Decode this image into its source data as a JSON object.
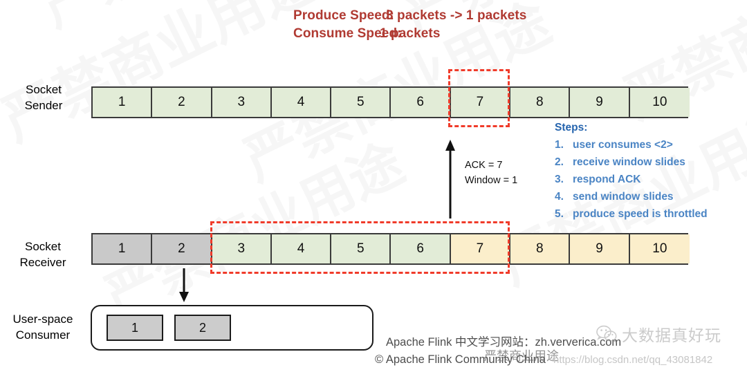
{
  "header": {
    "produce_label": "Produce Speed:",
    "produce_value": "3 packets -> 1 packets",
    "consume_label": "Consume Speed:",
    "consume_value": "1 packets",
    "accent_color": "#b03a32"
  },
  "sender": {
    "label_line1": "Socket",
    "label_line2": "Sender",
    "cells": [
      {
        "value": "1",
        "fill": "green"
      },
      {
        "value": "2",
        "fill": "green"
      },
      {
        "value": "3",
        "fill": "green"
      },
      {
        "value": "4",
        "fill": "green"
      },
      {
        "value": "5",
        "fill": "green"
      },
      {
        "value": "6",
        "fill": "green"
      },
      {
        "value": "7",
        "fill": "green"
      },
      {
        "value": "8",
        "fill": "green"
      },
      {
        "value": "9",
        "fill": "green"
      },
      {
        "value": "10",
        "fill": "green"
      }
    ],
    "window_highlight": "cell 7"
  },
  "receiver": {
    "label_line1": "Socket",
    "label_line2": "Receiver",
    "cells": [
      {
        "value": "1",
        "fill": "gray"
      },
      {
        "value": "2",
        "fill": "gray"
      },
      {
        "value": "3",
        "fill": "green"
      },
      {
        "value": "4",
        "fill": "green"
      },
      {
        "value": "5",
        "fill": "green"
      },
      {
        "value": "6",
        "fill": "green"
      },
      {
        "value": "7",
        "fill": "cream"
      },
      {
        "value": "8",
        "fill": "cream"
      },
      {
        "value": "9",
        "fill": "cream"
      },
      {
        "value": "10",
        "fill": "cream"
      }
    ],
    "window_highlight": "cells 3-7"
  },
  "ack": {
    "line1": "ACK = 7",
    "line2": "Window = 1"
  },
  "steps": {
    "title": "Steps:",
    "items": [
      {
        "num": "1.",
        "text": "user consumes <2>"
      },
      {
        "num": "2.",
        "text": "receive window slides"
      },
      {
        "num": "3.",
        "text": "respond ACK"
      },
      {
        "num": "4.",
        "text": "send window slides"
      },
      {
        "num": "5.",
        "text": "produce speed is throttled"
      }
    ],
    "color": "#4a84c4"
  },
  "consumer": {
    "label_line1": "User-space",
    "label_line2": "Consumer",
    "items": [
      {
        "value": "1"
      },
      {
        "value": "2"
      }
    ]
  },
  "footer": {
    "line1": "Apache Flink 中文学习网站：zh.ververica.com",
    "line2": "© Apache Flink Community China"
  },
  "watermarks": {
    "background_text": "严禁商业用途",
    "red_overlay_text": "严禁商业用途",
    "wechat_brand": "大数据真好玩",
    "csdn_text": "https://blog.csdn.net/qq_43081842"
  },
  "colors": {
    "cell_green": "#e2ecd7",
    "cell_gray": "#c9c9c9",
    "cell_cream": "#fbeecb",
    "dashed_red": "#f03b2a",
    "steps_blue": "#4a84c4",
    "speed_red": "#b03a32"
  }
}
